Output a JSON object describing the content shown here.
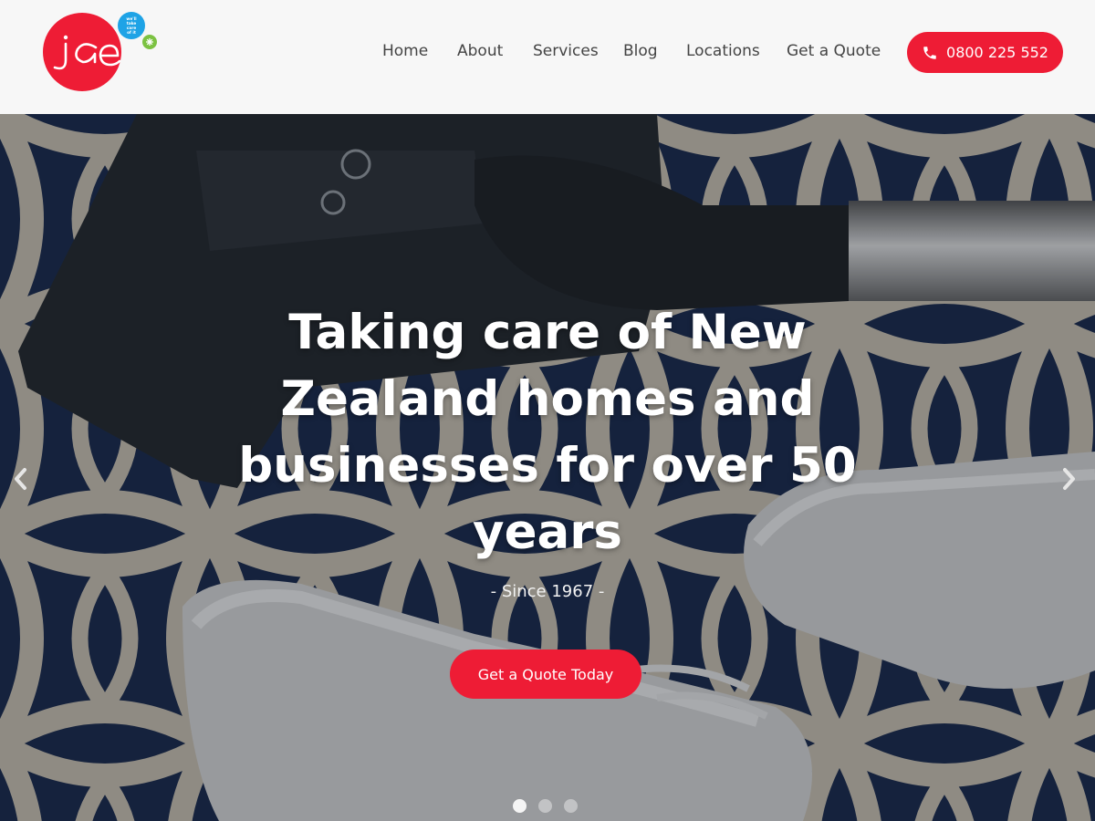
{
  "brand": {
    "logo_text": "jae",
    "tagline": "we'll take care of it",
    "colors": {
      "primary": "#ee1c35",
      "bubble_blue": "#1ea3e6",
      "bubble_green": "#7cc242"
    }
  },
  "nav": {
    "items": [
      {
        "label": "Home"
      },
      {
        "label": "About"
      },
      {
        "label": "Services"
      },
      {
        "label": "Blog"
      },
      {
        "label": "Locations"
      },
      {
        "label": "Get a Quote"
      }
    ],
    "phone": {
      "label": "0800 225 552",
      "icon": "phone-icon"
    }
  },
  "hero": {
    "title": "Taking care of New Zealand homes and businesses for over 50 years",
    "subtitle": "- Since 1967 -",
    "cta_label": "Get a Quote Today",
    "prev_icon": "chevron-left-icon",
    "next_icon": "chevron-right-icon",
    "slides": {
      "count": 3,
      "active_index": 0
    }
  }
}
